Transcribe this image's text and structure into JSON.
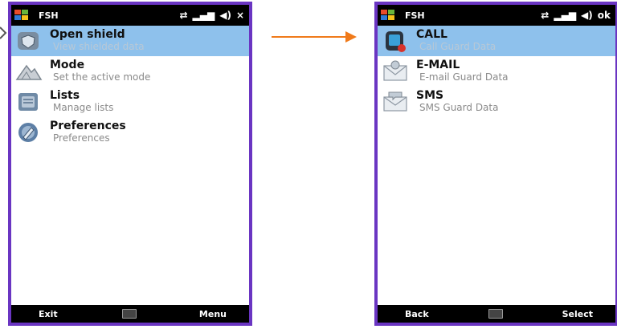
{
  "left_phone": {
    "app_title": "FSH",
    "status_close": "×",
    "items": [
      {
        "title": "Open shield",
        "subtitle": "View shielded data",
        "icon": "shield-icon",
        "selected": true
      },
      {
        "title": "Mode",
        "subtitle": "Set the active mode",
        "icon": "mountain-icon",
        "selected": false
      },
      {
        "title": "Lists",
        "subtitle": "Manage lists",
        "icon": "lists-icon",
        "selected": false
      },
      {
        "title": "Preferences",
        "subtitle": "Preferences",
        "icon": "preferences-icon",
        "selected": false
      }
    ],
    "softkey_left": "Exit",
    "softkey_right": "Menu"
  },
  "right_phone": {
    "app_title": "FSH",
    "status_ok": "ok",
    "items": [
      {
        "title": "CALL",
        "subtitle": "Call Guard Data",
        "icon": "phone-icon",
        "selected": true
      },
      {
        "title": "E-MAIL",
        "subtitle": "E-mail Guard Data",
        "icon": "envelope-icon",
        "selected": false
      },
      {
        "title": "SMS",
        "subtitle": "SMS Guard Data",
        "icon": "sms-envelope-icon",
        "selected": false
      }
    ],
    "softkey_left": "Back",
    "softkey_right": "Select"
  },
  "colors": {
    "frame": "#6a35c2",
    "selection": "#8ec1ec",
    "arrow": "#f07a1a"
  }
}
